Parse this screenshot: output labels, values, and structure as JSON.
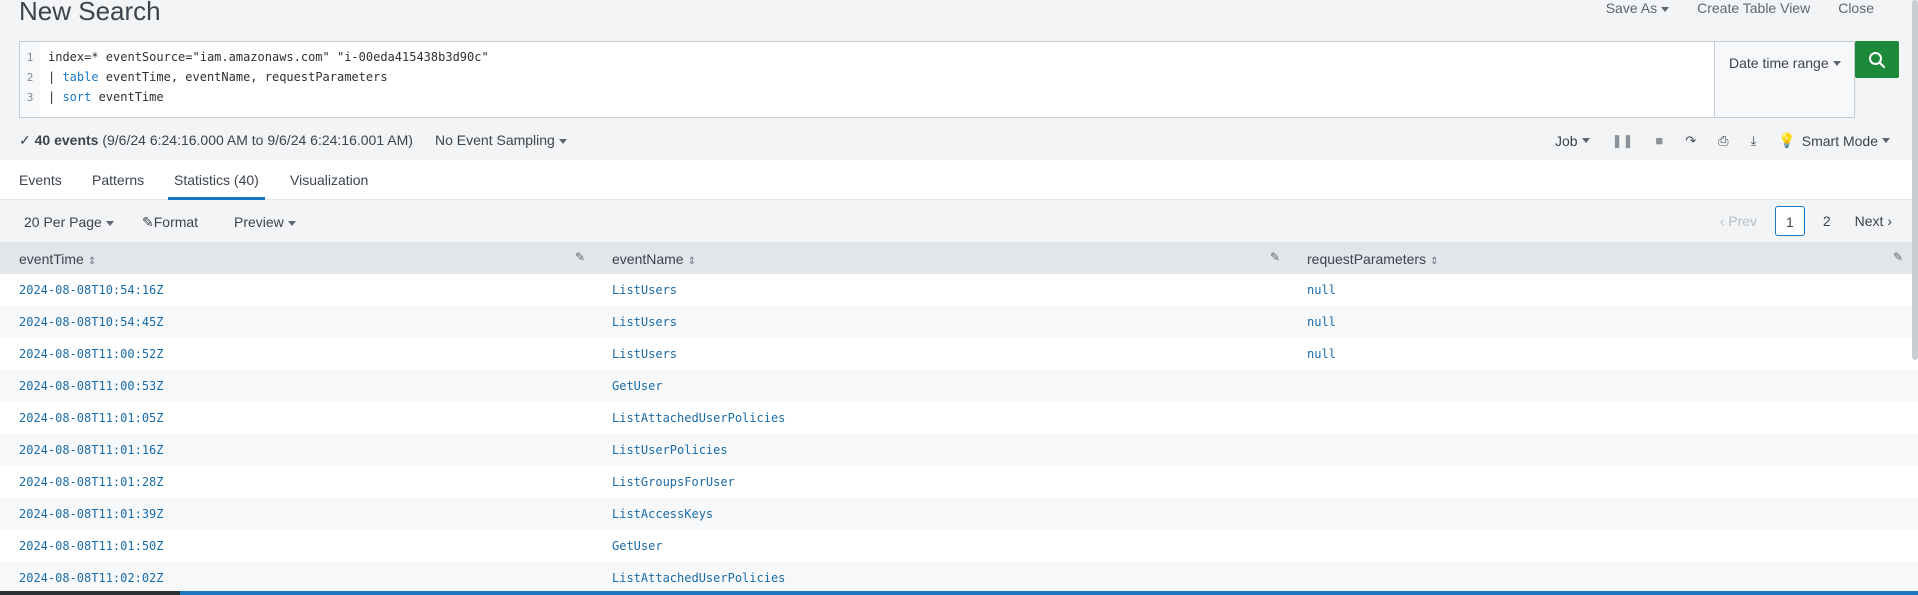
{
  "header": {
    "title": "New Search",
    "actions": [
      "Save As",
      "Create Table View",
      "Close"
    ]
  },
  "search": {
    "lines": [
      {
        "num": "1",
        "text": "index=* eventSource=\"iam.amazonaws.com\" \"i-00eda415438b3d90c\""
      },
      {
        "num": "2",
        "pipe": "| ",
        "kw": "table",
        "rest": " eventTime, eventName, requestParameters"
      },
      {
        "num": "3",
        "pipe": "| ",
        "kw": "sort",
        "rest": " eventTime"
      }
    ],
    "time_range": "Date time range"
  },
  "status": {
    "count": "40 events",
    "range": "(9/6/24 6:24:16.000 AM to 9/6/24 6:24:16.001 AM)",
    "sampling": "No Event Sampling",
    "job": "Job",
    "mode": "Smart Mode"
  },
  "tabs": [
    "Events",
    "Patterns",
    "Statistics (40)",
    "Visualization"
  ],
  "toolbar": {
    "per_page": "20 Per Page",
    "format": "Format",
    "preview": "Preview"
  },
  "pager": {
    "prev": "Prev",
    "pages": [
      "1",
      "2"
    ],
    "next": "Next"
  },
  "table": {
    "columns": [
      "eventTime",
      "eventName",
      "requestParameters"
    ],
    "rows": [
      [
        "2024-08-08T10:54:16Z",
        "ListUsers",
        "null"
      ],
      [
        "2024-08-08T10:54:45Z",
        "ListUsers",
        "null"
      ],
      [
        "2024-08-08T11:00:52Z",
        "ListUsers",
        "null"
      ],
      [
        "2024-08-08T11:00:53Z",
        "GetUser",
        ""
      ],
      [
        "2024-08-08T11:01:05Z",
        "ListAttachedUserPolicies",
        ""
      ],
      [
        "2024-08-08T11:01:16Z",
        "ListUserPolicies",
        ""
      ],
      [
        "2024-08-08T11:01:28Z",
        "ListGroupsForUser",
        ""
      ],
      [
        "2024-08-08T11:01:39Z",
        "ListAccessKeys",
        ""
      ],
      [
        "2024-08-08T11:01:50Z",
        "GetUser",
        ""
      ],
      [
        "2024-08-08T11:02:02Z",
        "ListAttachedUserPolicies",
        ""
      ]
    ]
  },
  "colors": {
    "accent": "#1a78c2",
    "search_button": "#1d8a3a",
    "link": "#1a6ca8"
  }
}
